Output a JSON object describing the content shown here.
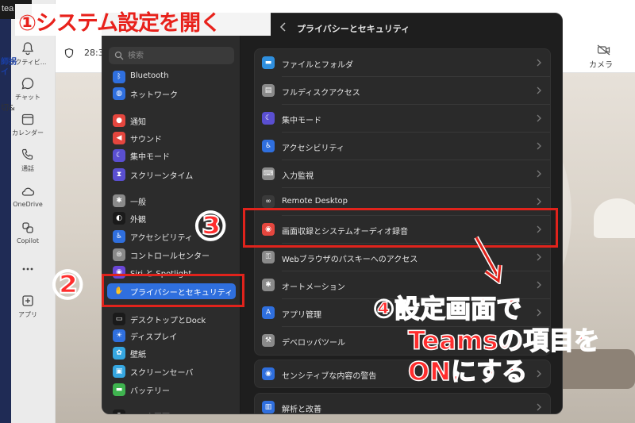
{
  "teams": {
    "window_title_fragment": "tea",
    "time_fragment": "28:3",
    "camera_label": "カメラ",
    "side_fragment_top": "師拐\nイ",
    "side_fragment_mid": "切&",
    "rail": [
      {
        "label": "アクティビ...",
        "icon": "bell-icon"
      },
      {
        "label": "チャット",
        "icon": "chat-icon"
      },
      {
        "label": "カレンダー",
        "icon": "calendar-icon"
      },
      {
        "label": "通話",
        "icon": "phone-icon"
      },
      {
        "label": "OneDrive",
        "icon": "cloud-icon"
      },
      {
        "label": "Copilot",
        "icon": "copilot-icon"
      },
      {
        "label": "",
        "icon": "more-icon"
      },
      {
        "label": "アプリ",
        "icon": "add-app-icon"
      }
    ]
  },
  "settings": {
    "search_placeholder": "検索",
    "page_title": "プライバシーとセキュリティ",
    "sidebar": [
      {
        "label": "Bluetooth",
        "icon": "bluetooth-icon",
        "color": "#2f6fde"
      },
      {
        "label": "ネットワーク",
        "icon": "globe-icon",
        "color": "#2f6fde"
      },
      {
        "label": "通知",
        "icon": "bell-icon",
        "color": "#e5463e"
      },
      {
        "label": "サウンド",
        "icon": "speaker-icon",
        "color": "#e5463e"
      },
      {
        "label": "集中モード",
        "icon": "moon-icon",
        "color": "#5a4fd1"
      },
      {
        "label": "スクリーンタイム",
        "icon": "hourglass-icon",
        "color": "#5a4fd1"
      },
      {
        "label": "一般",
        "icon": "gear-icon",
        "color": "#8a8a8a"
      },
      {
        "label": "外観",
        "icon": "appearance-icon",
        "color": "#1a1a1a"
      },
      {
        "label": "アクセシビリティ",
        "icon": "accessibility-icon",
        "color": "#2f6fde"
      },
      {
        "label": "コントロールセンター",
        "icon": "control-center-icon",
        "color": "#8a8a8a"
      },
      {
        "label": "Siri と Spotlight",
        "icon": "siri-icon",
        "color": "#6b47d6"
      },
      {
        "label": "プライバシーとセキュリティ",
        "icon": "hand-icon",
        "color": "#2f6fde",
        "selected": true
      },
      {
        "label": "デスクトップとDock",
        "icon": "dock-icon",
        "color": "#1a1a1a"
      },
      {
        "label": "ディスプレイ",
        "icon": "display-icon",
        "color": "#2f6fde"
      },
      {
        "label": "壁紙",
        "icon": "wallpaper-icon",
        "color": "#35a6e0"
      },
      {
        "label": "スクリーンセーバ",
        "icon": "screensaver-icon",
        "color": "#35a6e0"
      },
      {
        "label": "バッテリー",
        "icon": "battery-icon",
        "color": "#3fb34f"
      },
      {
        "label": "ロック画面",
        "icon": "lock-icon",
        "color": "#1a1a1a"
      }
    ],
    "rows": [
      {
        "label": "ファイルとフォルダ",
        "icon": "folder-icon",
        "color": "#2f8fde"
      },
      {
        "label": "フルディスクアクセス",
        "icon": "disk-icon",
        "color": "#8a8a8a"
      },
      {
        "label": "集中モード",
        "icon": "moon-icon",
        "color": "#5a4fd1"
      },
      {
        "label": "アクセシビリティ",
        "icon": "accessibility-icon",
        "color": "#2f6fde"
      },
      {
        "label": "入力監視",
        "icon": "keyboard-icon",
        "color": "#8a8a8a"
      },
      {
        "label": "Remote Desktop",
        "icon": "binoculars-icon",
        "color": "#3a3a3a"
      },
      {
        "label": "画面収録とシステムオーディオ録音",
        "icon": "record-icon",
        "color": "#e5463e"
      },
      {
        "label": "Webブラウザのパスキーへのアクセス",
        "icon": "person-key-icon",
        "color": "#8a8a8a"
      },
      {
        "label": "オートメーション",
        "icon": "gear-icon",
        "color": "#8a8a8a"
      },
      {
        "label": "アプリ管理",
        "icon": "app-store-icon",
        "color": "#2f6fde"
      },
      {
        "label": "デベロッパツール",
        "icon": "hammer-icon",
        "color": "#8a8a8a"
      }
    ],
    "rows2": [
      {
        "label": "センシティブな内容の警告",
        "icon": "eye-icon",
        "color": "#2f6fde"
      }
    ],
    "rows3": [
      {
        "label": "解析と改善",
        "icon": "chart-icon",
        "color": "#2f6fde"
      }
    ]
  },
  "annotations": {
    "step1": "①システム設定を開く",
    "step2": "②",
    "step3": "③",
    "step4_line1": "④設定画面で",
    "step4_line2": "Teamsの項目を",
    "step4_line3": "ONにする",
    "accent_color": "#e0231c"
  }
}
